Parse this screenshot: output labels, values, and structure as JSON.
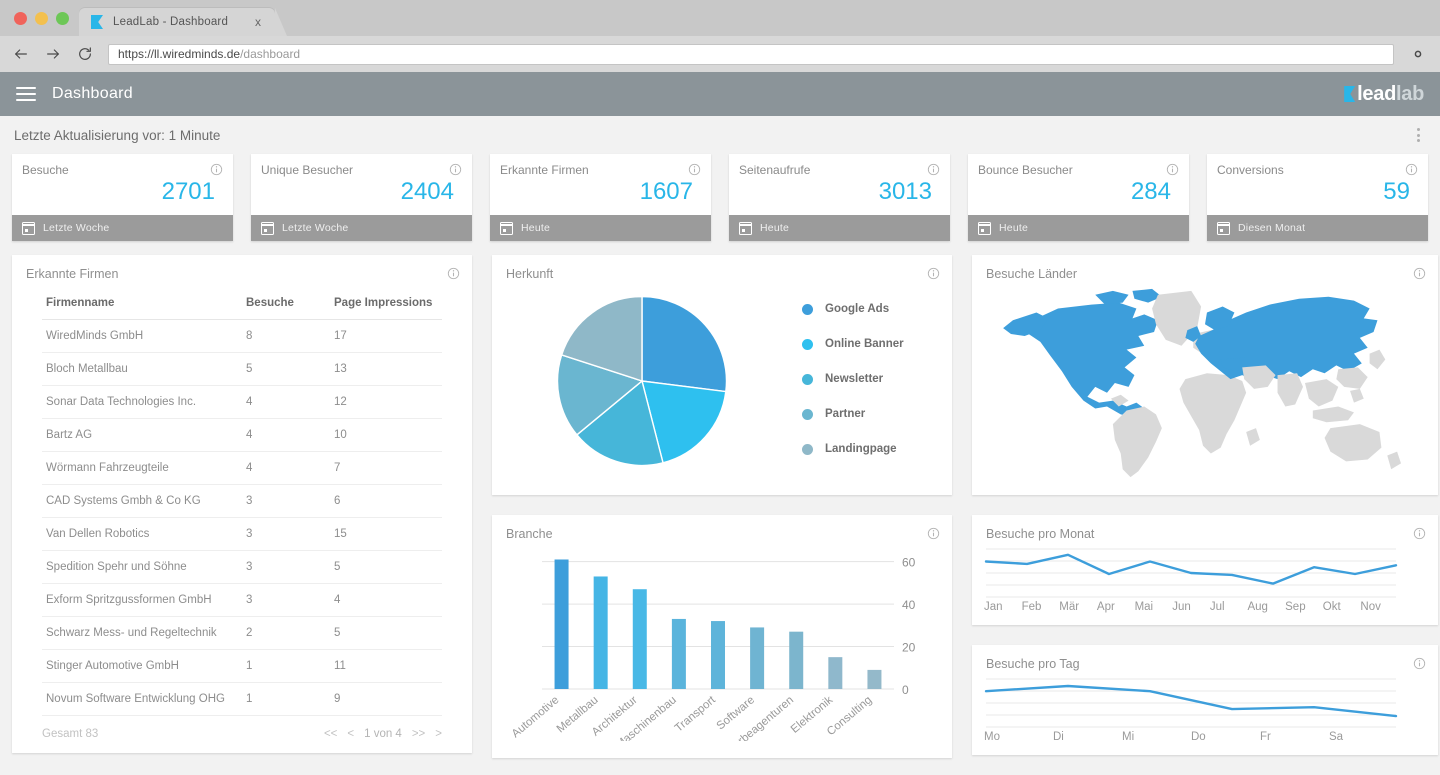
{
  "browser": {
    "tab": {
      "title": "LeadLab - Dashboard",
      "close_label": "x",
      "favicon": "leadlab-flag-icon"
    },
    "nav": {
      "back": "back-arrow-icon",
      "forward": "forward-arrow-icon",
      "reload": "reload-icon",
      "settings": "gear-icon"
    },
    "url": {
      "scheme_host": "https://ll.wiredminds.de",
      "path": "/dashboard",
      "full": "https://ll.wiredminds.de/dashboard"
    }
  },
  "appbar": {
    "menu_icon": "hamburger-icon",
    "title": "Dashboard",
    "logo": {
      "lead": "lead",
      "lab": "lab"
    }
  },
  "header": {
    "updated": "Letzte Aktualisierung vor: 1 Minute",
    "menu_icon": "kebab-menu-icon"
  },
  "kpis": [
    {
      "label": "Besuche",
      "value": "2701",
      "period": "Letzte Woche"
    },
    {
      "label": "Unique Besucher",
      "value": "2404",
      "period": "Letzte Woche"
    },
    {
      "label": "Erkannte Firmen",
      "value": "1607",
      "period": "Heute"
    },
    {
      "label": "Seitenaufrufe",
      "value": "3013",
      "period": "Heute"
    },
    {
      "label": "Bounce Besucher",
      "value": "284",
      "period": "Heute"
    },
    {
      "label": "Conversions",
      "value": "59",
      "period": "Diesen Monat"
    }
  ],
  "companies_panel": {
    "title": "Erkannte Firmen",
    "columns": [
      "Firmenname",
      "Besuche",
      "Page Impressions"
    ],
    "rows": [
      [
        "WiredMinds GmbH",
        "8",
        "17"
      ],
      [
        "Bloch Metallbau",
        "5",
        "13"
      ],
      [
        "Sonar Data Technologies Inc.",
        "4",
        "12"
      ],
      [
        "Bartz AG",
        "4",
        "10"
      ],
      [
        "Wörmann Fahrzeugteile",
        "4",
        "7"
      ],
      [
        "CAD Systems Gmbh & Co KG",
        "3",
        "6"
      ],
      [
        "Van Dellen Robotics",
        "3",
        "15"
      ],
      [
        "Spedition Spehr und Söhne",
        "3",
        "5"
      ],
      [
        "Exform Spritzgussformen GmbH",
        "3",
        "4"
      ],
      [
        "Schwarz Mess- und Regeltechnik",
        "2",
        "5"
      ],
      [
        "Stinger Automotive GmbH",
        "1",
        "11"
      ],
      [
        "Novum Software Entwicklung OHG",
        "1",
        "9"
      ]
    ],
    "total": "Gesamt 83",
    "pager": {
      "first": "<<",
      "prev": "<",
      "label": "1 von 4",
      "last": ">>",
      "next": ">"
    }
  },
  "herkunft_panel": {
    "title": "Herkunft"
  },
  "branche_panel": {
    "title": "Branche"
  },
  "map_panel": {
    "title": "Besuche  Länder",
    "highlight_color": "#3d9edb",
    "base_color": "#d9d9d9"
  },
  "monat_panel": {
    "title": "Besuche pro Monat"
  },
  "tag_panel": {
    "title": "Besuche pro Tag"
  },
  "colors": {
    "accent": "#29b6e8",
    "line": "#3d9edb",
    "appbar": "#8b9499",
    "kpi_footer": "#9b9b9b"
  },
  "chart_data": [
    {
      "type": "pie",
      "title": "Herkunft",
      "legend_position": "right",
      "labels": [
        "Google Ads",
        "Online Banner",
        "Newsletter",
        "Partner",
        "Landingpage"
      ],
      "values": [
        27,
        19,
        18,
        16,
        20
      ],
      "colors": [
        "#3d9edb",
        "#2ec0ef",
        "#46b6d9",
        "#6ab6d0",
        "#8fb8c8"
      ]
    },
    {
      "type": "bar",
      "title": "Branche",
      "categories": [
        "Automotive",
        "Metallbau",
        "Architektur",
        "Maschinenbau",
        "Transport",
        "Software",
        "Werbeagenturen",
        "Elektronik",
        "Consulting"
      ],
      "values": [
        61,
        53,
        47,
        33,
        32,
        29,
        27,
        15,
        9
      ],
      "colors": [
        "#3d9edb",
        "#45b5e5",
        "#48b8e6",
        "#5ab4dc",
        "#5eb4da",
        "#6fb4d2",
        "#7cb5cd",
        "#8fb8cc",
        "#94b9ca"
      ],
      "ylabel": "",
      "xlabel": "",
      "ylim": [
        0,
        65
      ],
      "yticks": [
        0,
        20,
        40,
        60
      ],
      "grid": true
    },
    {
      "type": "line",
      "title": "Besuche pro Monat",
      "x": [
        "Jan",
        "Feb",
        "Mär",
        "Apr",
        "Mai",
        "Jun",
        "Jul",
        "Aug",
        "Sep",
        "Okt",
        "Nov"
      ],
      "values": [
        3700,
        3450,
        4400,
        2400,
        3700,
        2500,
        2300,
        1400,
        3100,
        2400,
        3300
      ],
      "ylim": [
        0,
        5000
      ],
      "yticks": [
        0,
        5000
      ],
      "ytick_labels": [
        "0",
        "5000"
      ],
      "color": "#3d9edb",
      "grid": true
    },
    {
      "type": "line",
      "title": "Besuche pro Tag",
      "x": [
        "Mo",
        "Di",
        "Mi",
        "Do",
        "Fr",
        "Sa"
      ],
      "values": [
        560,
        640,
        560,
        280,
        310,
        170
      ],
      "ylim": [
        0,
        750
      ],
      "yticks": [
        0,
        750
      ],
      "ytick_labels": [
        "0",
        "750"
      ],
      "color": "#3d9edb",
      "grid": true
    }
  ]
}
